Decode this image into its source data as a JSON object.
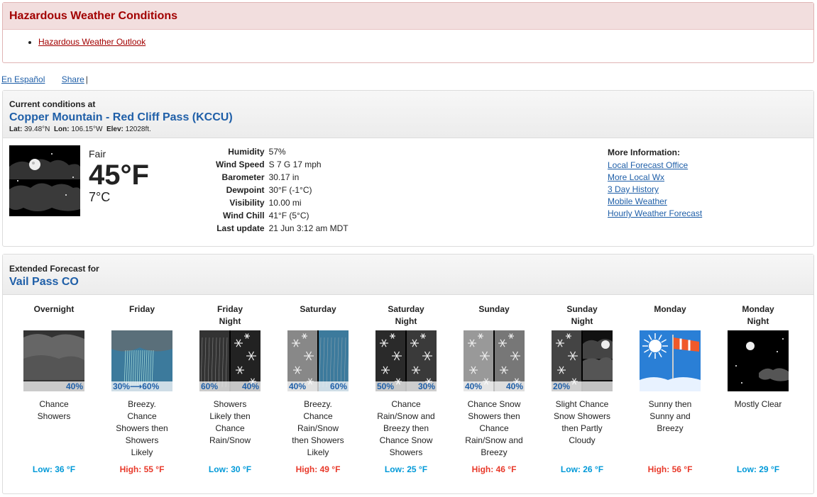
{
  "hazard": {
    "title": "Hazardous Weather Conditions",
    "link": "Hazardous Weather Outlook"
  },
  "utility": {
    "espanol": "En Español",
    "share": "Share",
    "sep": "|"
  },
  "current": {
    "heading": "Current conditions at",
    "station": "Copper Mountain - Red Cliff Pass (KCCU)",
    "lat_label": "Lat:",
    "lat": "39.48°N",
    "lon_label": "Lon:",
    "lon": "106.15°W",
    "elev_label": "Elev:",
    "elev": "12028ft.",
    "summary": "Fair",
    "temp_f": "45°F",
    "temp_c": "7°C",
    "rows": [
      {
        "label": "Humidity",
        "value": "57%"
      },
      {
        "label": "Wind Speed",
        "value": "S 7 G 17 mph"
      },
      {
        "label": "Barometer",
        "value": "30.17 in"
      },
      {
        "label": "Dewpoint",
        "value": "30°F (-1°C)"
      },
      {
        "label": "Visibility",
        "value": "10.00 mi"
      },
      {
        "label": "Wind Chill",
        "value": "41°F (5°C)"
      },
      {
        "label": "Last update",
        "value": "21 Jun 3:12 am MDT"
      }
    ],
    "more_info": {
      "heading": "More Information:",
      "links": [
        "Local Forecast Office",
        "More Local Wx",
        "3 Day History",
        "Mobile Weather",
        "Hourly Weather Forecast"
      ]
    }
  },
  "extended": {
    "heading": "Extended Forecast for",
    "location": "Vail Pass CO",
    "days": [
      {
        "name1": "Overnight",
        "name2": "",
        "pop": [
          "",
          "40%"
        ],
        "icon": "showers-night",
        "short": [
          "Chance",
          "Showers"
        ],
        "temp": "Low: 36 °F",
        "kind": "low"
      },
      {
        "name1": "Friday",
        "name2": "",
        "pop": [
          "30%⟶60%"
        ],
        "icon": "showers-day",
        "short": [
          "Breezy.",
          "Chance",
          "Showers then",
          "Showers",
          "Likely"
        ],
        "temp": "High: 55 °F",
        "kind": "high"
      },
      {
        "name1": "Friday",
        "name2": "Night",
        "pop": [
          "60%",
          "40%"
        ],
        "icon": "rain-snow-night",
        "short": [
          "Showers",
          "Likely then",
          "Chance",
          "Rain/Snow"
        ],
        "temp": "Low: 30 °F",
        "kind": "low"
      },
      {
        "name1": "Saturday",
        "name2": "",
        "pop": [
          "40%",
          "60%"
        ],
        "icon": "rainsnow-day",
        "short": [
          "Breezy.",
          "Chance",
          "Rain/Snow",
          "then Showers",
          "Likely"
        ],
        "temp": "High: 49 °F",
        "kind": "high"
      },
      {
        "name1": "Saturday",
        "name2": "Night",
        "pop": [
          "50%",
          "30%"
        ],
        "icon": "rainsnow-snow-night",
        "short": [
          "Chance",
          "Rain/Snow and",
          "Breezy then",
          "Chance Snow",
          "Showers"
        ],
        "temp": "Low: 25 °F",
        "kind": "low"
      },
      {
        "name1": "Sunday",
        "name2": "",
        "pop": [
          "40%",
          "40%"
        ],
        "icon": "snow-rainsnow-day",
        "short": [
          "Chance Snow",
          "Showers then",
          "Chance",
          "Rain/Snow and",
          "Breezy"
        ],
        "temp": "High: 46 °F",
        "kind": "high"
      },
      {
        "name1": "Sunday",
        "name2": "Night",
        "pop": [
          "20%"
        ],
        "icon": "snow-pcloudy-night",
        "short": [
          "Slight Chance",
          "Snow Showers",
          "then Partly",
          "Cloudy"
        ],
        "temp": "Low: 26 °F",
        "kind": "low"
      },
      {
        "name1": "Monday",
        "name2": "",
        "pop": [],
        "icon": "sunny-windy",
        "short": [
          "Sunny then",
          "Sunny and",
          "Breezy"
        ],
        "temp": "High: 56 °F",
        "kind": "high"
      },
      {
        "name1": "Monday",
        "name2": "Night",
        "pop": [],
        "icon": "clear-night",
        "short": [
          "Mostly Clear"
        ],
        "temp": "Low: 29 °F",
        "kind": "low"
      }
    ]
  }
}
